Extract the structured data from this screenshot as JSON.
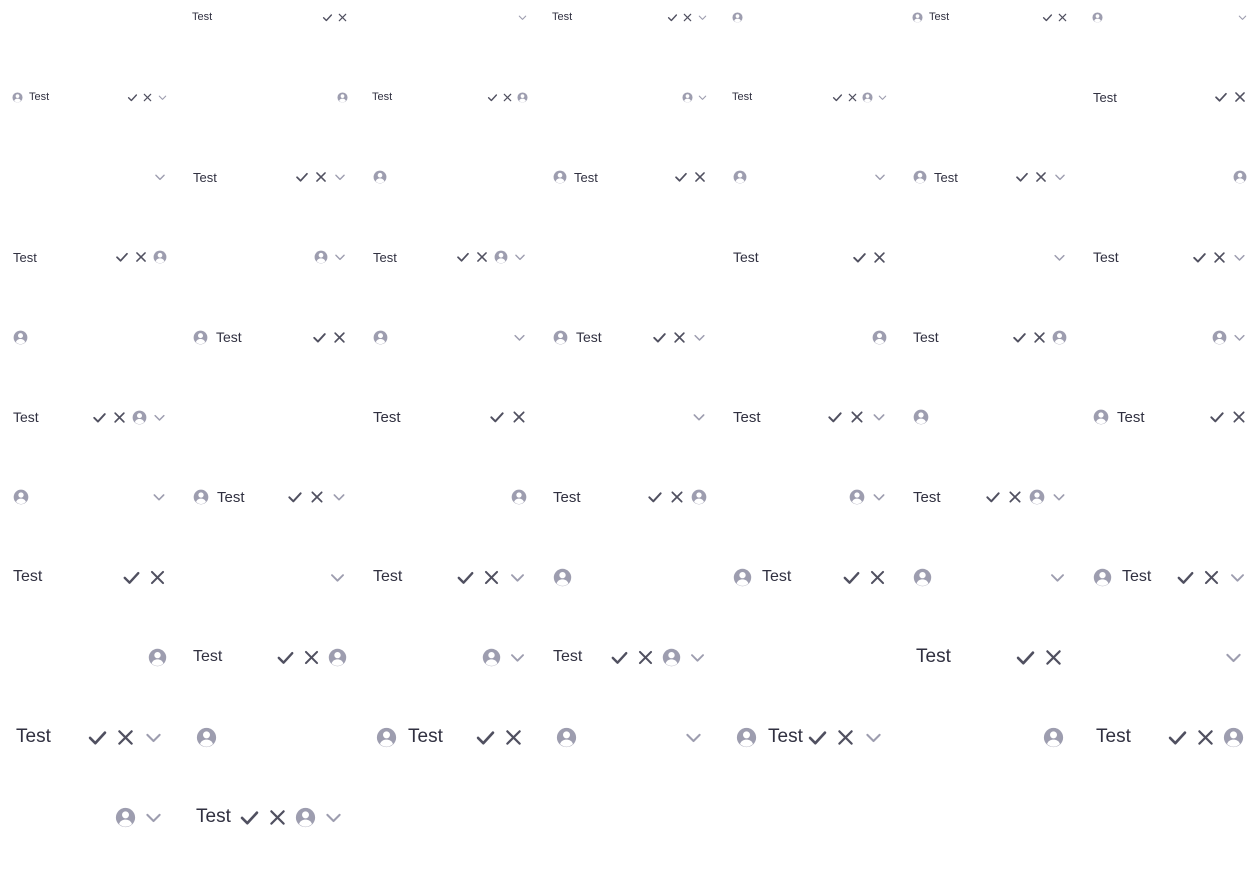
{
  "label_text": "Test",
  "icon_color_dark": "#505060",
  "icon_color_light": "#9d9daf",
  "fields": [
    {
      "col": 1,
      "row": 0,
      "s": 1,
      "label": true,
      "accept": true,
      "clear": true
    },
    {
      "col": 2,
      "row": 0,
      "s": 1,
      "chevron": true
    },
    {
      "col": 3,
      "row": 0,
      "s": 1,
      "label": true,
      "accept": true,
      "clear": true,
      "chevron": true
    },
    {
      "col": 4,
      "row": 0,
      "s": 1,
      "avatar": true
    },
    {
      "col": 5,
      "row": 0,
      "s": 1,
      "avatar": true,
      "label": true,
      "accept": true,
      "clear": true
    },
    {
      "col": 6,
      "row": 0,
      "s": 1,
      "avatar": true,
      "chevron": true
    },
    {
      "col": 0,
      "row": 1,
      "s": 1,
      "avatar": true,
      "label": true,
      "accept": true,
      "clear": true,
      "chevron": true
    },
    {
      "col": 1,
      "row": 1,
      "s": 1,
      "avatarEnd": true
    },
    {
      "col": 2,
      "row": 1,
      "s": 1,
      "label": true,
      "accept": true,
      "clear": true,
      "avatarEnd": true
    },
    {
      "col": 3,
      "row": 1,
      "s": 1,
      "avatarEnd": true,
      "chevron": true
    },
    {
      "col": 4,
      "row": 1,
      "s": 1,
      "label": true,
      "accept": true,
      "clear": true,
      "avatarEnd": true,
      "chevron": true
    },
    {
      "col": 6,
      "row": 1,
      "s": 2,
      "label": true,
      "accept": true,
      "clear": true
    },
    {
      "col": 0,
      "row": 2,
      "s": 2,
      "chevron": true
    },
    {
      "col": 1,
      "row": 2,
      "s": 2,
      "label": true,
      "accept": true,
      "clear": true,
      "chevron": true
    },
    {
      "col": 2,
      "row": 2,
      "s": 2,
      "avatar": true
    },
    {
      "col": 3,
      "row": 2,
      "s": 2,
      "avatar": true,
      "label": true,
      "accept": true,
      "clear": true
    },
    {
      "col": 4,
      "row": 2,
      "s": 2,
      "avatar": true,
      "chevron": true
    },
    {
      "col": 5,
      "row": 2,
      "s": 2,
      "avatar": true,
      "label": true,
      "accept": true,
      "clear": true,
      "chevron": true
    },
    {
      "col": 6,
      "row": 2,
      "s": 2,
      "avatarEnd": true
    },
    {
      "col": 0,
      "row": 3,
      "s": 2,
      "label": true,
      "accept": true,
      "clear": true,
      "avatarEnd": true
    },
    {
      "col": 1,
      "row": 3,
      "s": 2,
      "avatarEnd": true,
      "chevron": true
    },
    {
      "col": 2,
      "row": 3,
      "s": 2,
      "label": true,
      "accept": true,
      "clear": true,
      "avatarEnd": true,
      "chevron": true
    },
    {
      "col": 4,
      "row": 3,
      "s": 3,
      "label": true,
      "accept": true,
      "clear": true
    },
    {
      "col": 5,
      "row": 3,
      "s": 3,
      "chevron": true
    },
    {
      "col": 6,
      "row": 3,
      "s": 3,
      "label": true,
      "accept": true,
      "clear": true,
      "chevron": true
    },
    {
      "col": 0,
      "row": 4,
      "s": 3,
      "avatar": true
    },
    {
      "col": 1,
      "row": 4,
      "s": 3,
      "avatar": true,
      "label": true,
      "accept": true,
      "clear": true
    },
    {
      "col": 2,
      "row": 4,
      "s": 3,
      "avatar": true,
      "chevron": true
    },
    {
      "col": 3,
      "row": 4,
      "s": 3,
      "avatar": true,
      "label": true,
      "accept": true,
      "clear": true,
      "chevron": true
    },
    {
      "col": 4,
      "row": 4,
      "s": 3,
      "avatarEnd": true
    },
    {
      "col": 5,
      "row": 4,
      "s": 3,
      "label": true,
      "accept": true,
      "clear": true,
      "avatarEnd": true
    },
    {
      "col": 6,
      "row": 4,
      "s": 3,
      "avatarEnd": true,
      "chevron": true
    },
    {
      "col": 0,
      "row": 5,
      "s": 3,
      "label": true,
      "accept": true,
      "clear": true,
      "avatarEnd": true,
      "chevron": true
    },
    {
      "col": 2,
      "row": 5,
      "s": 4,
      "label": true,
      "accept": true,
      "clear": true
    },
    {
      "col": 3,
      "row": 5,
      "s": 4,
      "chevron": true
    },
    {
      "col": 4,
      "row": 5,
      "s": 4,
      "label": true,
      "accept": true,
      "clear": true,
      "chevron": true
    },
    {
      "col": 5,
      "row": 5,
      "s": 4,
      "avatar": true
    },
    {
      "col": 6,
      "row": 5,
      "s": 4,
      "avatar": true,
      "label": true,
      "accept": true,
      "clear": true
    },
    {
      "col": 0,
      "row": 6,
      "s": 4,
      "avatar": true,
      "chevron": true
    },
    {
      "col": 1,
      "row": 6,
      "s": 4,
      "avatar": true,
      "label": true,
      "accept": true,
      "clear": true,
      "chevron": true
    },
    {
      "col": 2,
      "row": 6,
      "s": 4,
      "avatarEnd": true
    },
    {
      "col": 3,
      "row": 6,
      "s": 4,
      "label": true,
      "accept": true,
      "clear": true,
      "avatarEnd": true
    },
    {
      "col": 4,
      "row": 6,
      "s": 4,
      "avatarEnd": true,
      "chevron": true
    },
    {
      "col": 5,
      "row": 6,
      "s": 4,
      "label": true,
      "accept": true,
      "clear": true,
      "avatarEnd": true,
      "chevron": true
    },
    {
      "col": 0,
      "row": 7,
      "s": 5,
      "label": true,
      "accept": true,
      "clear": true
    },
    {
      "col": 1,
      "row": 7,
      "s": 5,
      "chevron": true
    },
    {
      "col": 2,
      "row": 7,
      "s": 5,
      "label": true,
      "accept": true,
      "clear": true,
      "chevron": true
    },
    {
      "col": 3,
      "row": 7,
      "s": 5,
      "avatar": true
    },
    {
      "col": 4,
      "row": 7,
      "s": 5,
      "avatar": true,
      "label": true,
      "accept": true,
      "clear": true
    },
    {
      "col": 5,
      "row": 7,
      "s": 5,
      "avatar": true,
      "chevron": true
    },
    {
      "col": 6,
      "row": 7,
      "s": 5,
      "avatar": true,
      "label": true,
      "accept": true,
      "clear": true,
      "chevron": true
    },
    {
      "col": 0,
      "row": 8,
      "s": 5,
      "avatarEnd": true
    },
    {
      "col": 1,
      "row": 8,
      "s": 5,
      "label": true,
      "accept": true,
      "clear": true,
      "avatarEnd": true
    },
    {
      "col": 2,
      "row": 8,
      "s": 5,
      "avatarEnd": true,
      "chevron": true
    },
    {
      "col": 3,
      "row": 8,
      "s": 5,
      "label": true,
      "accept": true,
      "clear": true,
      "avatarEnd": true,
      "chevron": true
    },
    {
      "col": 5,
      "row": 8,
      "s": 6,
      "label": true,
      "accept": true,
      "clear": true
    },
    {
      "col": 6,
      "row": 8,
      "s": 6,
      "chevron": true
    },
    {
      "col": 0,
      "row": 9,
      "s": 6,
      "label": true,
      "accept": true,
      "clear": true,
      "chevron": true
    },
    {
      "col": 1,
      "row": 9,
      "s": 6,
      "avatar": true
    },
    {
      "col": 2,
      "row": 9,
      "s": 6,
      "avatar": true,
      "label": true,
      "accept": true,
      "clear": true
    },
    {
      "col": 3,
      "row": 9,
      "s": 6,
      "avatar": true,
      "chevron": true
    },
    {
      "col": 4,
      "row": 9,
      "s": 6,
      "avatar": true,
      "label": true,
      "accept": true,
      "clear": true,
      "chevron": true
    },
    {
      "col": 5,
      "row": 9,
      "s": 6,
      "avatarEnd": true
    },
    {
      "col": 6,
      "row": 9,
      "s": 6,
      "label": true,
      "accept": true,
      "clear": true,
      "avatarEnd": true
    },
    {
      "col": 0,
      "row": 10,
      "s": 6,
      "avatarEnd": true,
      "chevron": true
    },
    {
      "col": 1,
      "row": 10,
      "s": 6,
      "label": true,
      "accept": true,
      "clear": true,
      "avatarEnd": true,
      "chevron": true
    }
  ]
}
